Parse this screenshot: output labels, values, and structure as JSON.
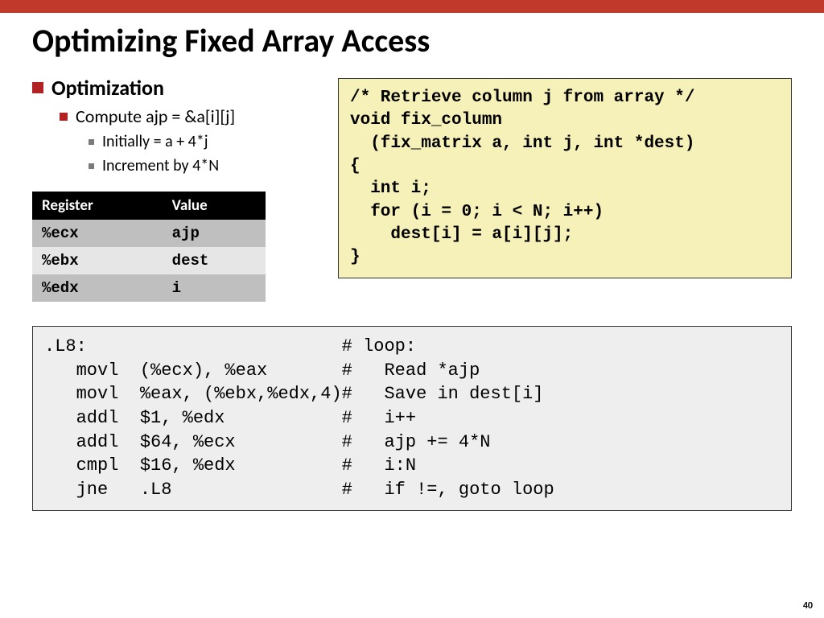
{
  "title": "Optimizing Fixed Array Access",
  "bullets": {
    "b1": "Optimization",
    "b2": "Compute ajp = &a[i][j]",
    "b3a": "Initially = a + 4*j",
    "b3b": "Increment by 4*N"
  },
  "table": {
    "h1": "Register",
    "h2": "Value",
    "rows": [
      {
        "reg": "%ecx",
        "val": "ajp"
      },
      {
        "reg": "%ebx",
        "val": "dest"
      },
      {
        "reg": "%edx",
        "val": "i"
      }
    ]
  },
  "code_c": "/* Retrieve column j from array */\nvoid fix_column\n  (fix_matrix a, int j, int *dest)\n{\n  int i;\n  for (i = 0; i < N; i++)\n    dest[i] = a[i][j];\n}",
  "code_asm": ".L8:                        # loop:\n   movl  (%ecx), %eax       #   Read *ajp\n   movl  %eax, (%ebx,%edx,4)#   Save in dest[i]\n   addl  $1, %edx           #   i++\n   addl  $64, %ecx          #   ajp += 4*N\n   cmpl  $16, %edx          #   i:N\n   jne   .L8                #   if !=, goto loop",
  "page_number": "40"
}
